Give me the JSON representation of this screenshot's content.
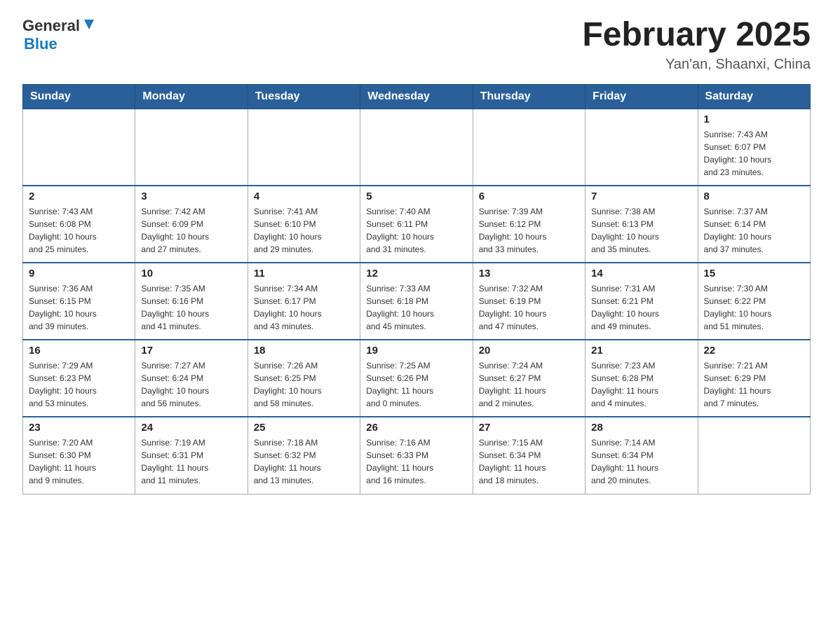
{
  "header": {
    "logo_general": "General",
    "logo_blue": "Blue",
    "month_title": "February 2025",
    "location": "Yan'an, Shaanxi, China"
  },
  "weekdays": [
    "Sunday",
    "Monday",
    "Tuesday",
    "Wednesday",
    "Thursday",
    "Friday",
    "Saturday"
  ],
  "weeks": [
    [
      {
        "day": "",
        "info": ""
      },
      {
        "day": "",
        "info": ""
      },
      {
        "day": "",
        "info": ""
      },
      {
        "day": "",
        "info": ""
      },
      {
        "day": "",
        "info": ""
      },
      {
        "day": "",
        "info": ""
      },
      {
        "day": "1",
        "info": "Sunrise: 7:43 AM\nSunset: 6:07 PM\nDaylight: 10 hours\nand 23 minutes."
      }
    ],
    [
      {
        "day": "2",
        "info": "Sunrise: 7:43 AM\nSunset: 6:08 PM\nDaylight: 10 hours\nand 25 minutes."
      },
      {
        "day": "3",
        "info": "Sunrise: 7:42 AM\nSunset: 6:09 PM\nDaylight: 10 hours\nand 27 minutes."
      },
      {
        "day": "4",
        "info": "Sunrise: 7:41 AM\nSunset: 6:10 PM\nDaylight: 10 hours\nand 29 minutes."
      },
      {
        "day": "5",
        "info": "Sunrise: 7:40 AM\nSunset: 6:11 PM\nDaylight: 10 hours\nand 31 minutes."
      },
      {
        "day": "6",
        "info": "Sunrise: 7:39 AM\nSunset: 6:12 PM\nDaylight: 10 hours\nand 33 minutes."
      },
      {
        "day": "7",
        "info": "Sunrise: 7:38 AM\nSunset: 6:13 PM\nDaylight: 10 hours\nand 35 minutes."
      },
      {
        "day": "8",
        "info": "Sunrise: 7:37 AM\nSunset: 6:14 PM\nDaylight: 10 hours\nand 37 minutes."
      }
    ],
    [
      {
        "day": "9",
        "info": "Sunrise: 7:36 AM\nSunset: 6:15 PM\nDaylight: 10 hours\nand 39 minutes."
      },
      {
        "day": "10",
        "info": "Sunrise: 7:35 AM\nSunset: 6:16 PM\nDaylight: 10 hours\nand 41 minutes."
      },
      {
        "day": "11",
        "info": "Sunrise: 7:34 AM\nSunset: 6:17 PM\nDaylight: 10 hours\nand 43 minutes."
      },
      {
        "day": "12",
        "info": "Sunrise: 7:33 AM\nSunset: 6:18 PM\nDaylight: 10 hours\nand 45 minutes."
      },
      {
        "day": "13",
        "info": "Sunrise: 7:32 AM\nSunset: 6:19 PM\nDaylight: 10 hours\nand 47 minutes."
      },
      {
        "day": "14",
        "info": "Sunrise: 7:31 AM\nSunset: 6:21 PM\nDaylight: 10 hours\nand 49 minutes."
      },
      {
        "day": "15",
        "info": "Sunrise: 7:30 AM\nSunset: 6:22 PM\nDaylight: 10 hours\nand 51 minutes."
      }
    ],
    [
      {
        "day": "16",
        "info": "Sunrise: 7:29 AM\nSunset: 6:23 PM\nDaylight: 10 hours\nand 53 minutes."
      },
      {
        "day": "17",
        "info": "Sunrise: 7:27 AM\nSunset: 6:24 PM\nDaylight: 10 hours\nand 56 minutes."
      },
      {
        "day": "18",
        "info": "Sunrise: 7:26 AM\nSunset: 6:25 PM\nDaylight: 10 hours\nand 58 minutes."
      },
      {
        "day": "19",
        "info": "Sunrise: 7:25 AM\nSunset: 6:26 PM\nDaylight: 11 hours\nand 0 minutes."
      },
      {
        "day": "20",
        "info": "Sunrise: 7:24 AM\nSunset: 6:27 PM\nDaylight: 11 hours\nand 2 minutes."
      },
      {
        "day": "21",
        "info": "Sunrise: 7:23 AM\nSunset: 6:28 PM\nDaylight: 11 hours\nand 4 minutes."
      },
      {
        "day": "22",
        "info": "Sunrise: 7:21 AM\nSunset: 6:29 PM\nDaylight: 11 hours\nand 7 minutes."
      }
    ],
    [
      {
        "day": "23",
        "info": "Sunrise: 7:20 AM\nSunset: 6:30 PM\nDaylight: 11 hours\nand 9 minutes."
      },
      {
        "day": "24",
        "info": "Sunrise: 7:19 AM\nSunset: 6:31 PM\nDaylight: 11 hours\nand 11 minutes."
      },
      {
        "day": "25",
        "info": "Sunrise: 7:18 AM\nSunset: 6:32 PM\nDaylight: 11 hours\nand 13 minutes."
      },
      {
        "day": "26",
        "info": "Sunrise: 7:16 AM\nSunset: 6:33 PM\nDaylight: 11 hours\nand 16 minutes."
      },
      {
        "day": "27",
        "info": "Sunrise: 7:15 AM\nSunset: 6:34 PM\nDaylight: 11 hours\nand 18 minutes."
      },
      {
        "day": "28",
        "info": "Sunrise: 7:14 AM\nSunset: 6:34 PM\nDaylight: 11 hours\nand 20 minutes."
      },
      {
        "day": "",
        "info": ""
      }
    ]
  ]
}
